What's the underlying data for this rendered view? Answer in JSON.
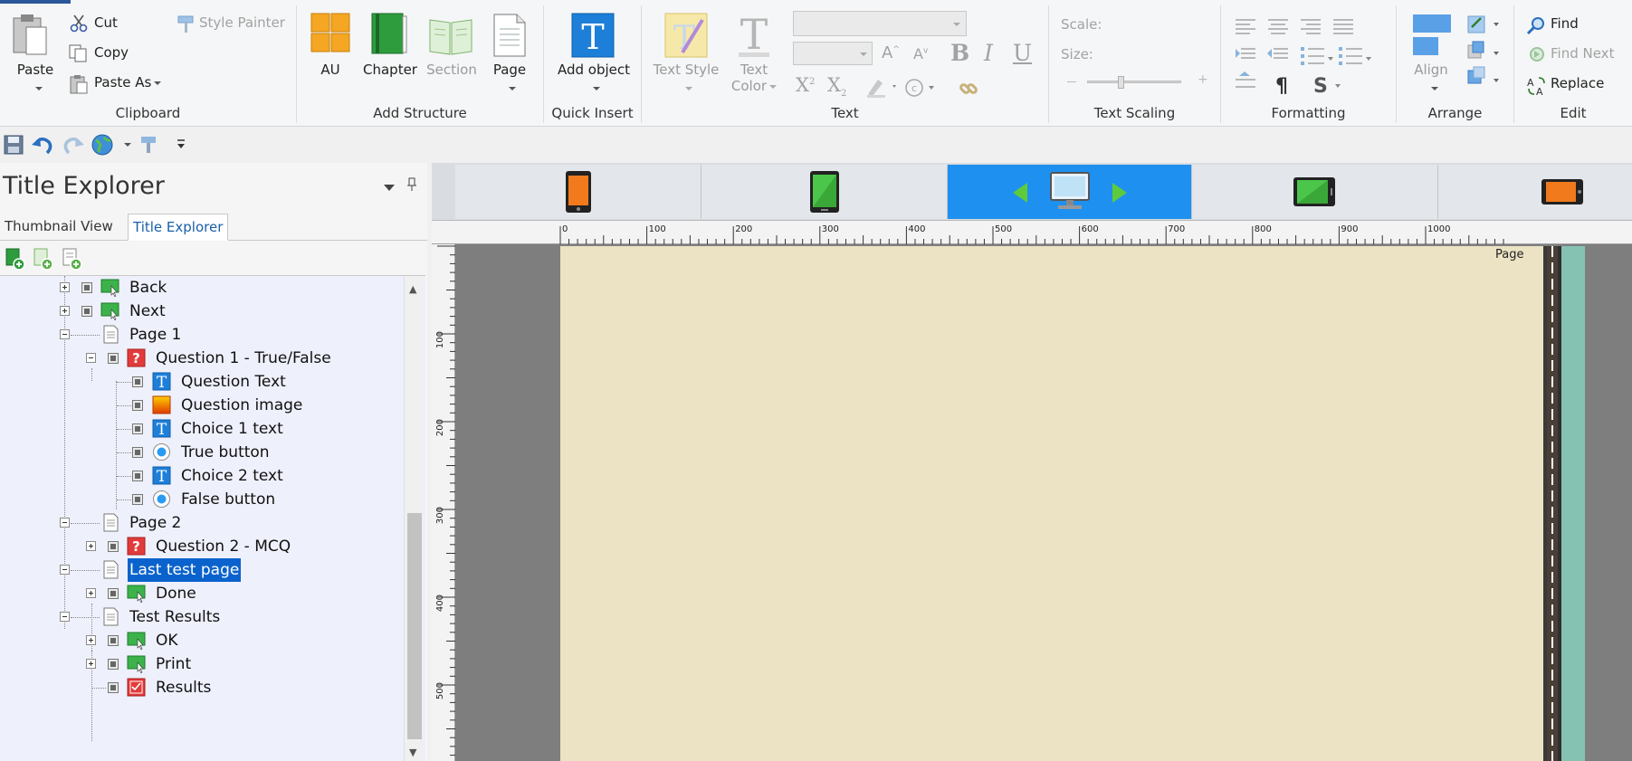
{
  "ribbon": {
    "clipboard": {
      "label": "Clipboard",
      "paste": "Paste",
      "cut": "Cut",
      "copy": "Copy",
      "paste_as": "Paste As",
      "style_painter": "Style Painter"
    },
    "add_structure": {
      "label": "Add Structure",
      "au": "AU",
      "chapter": "Chapter",
      "section": "Section",
      "page": "Page"
    },
    "quick_insert": {
      "label": "Quick Insert",
      "add_object": "Add object"
    },
    "text": {
      "label": "Text",
      "text_style": "Text Style",
      "text_color_1": "Text",
      "text_color_2": "Color",
      "bold": "B",
      "italic": "I",
      "underline": "U"
    },
    "text_scaling": {
      "label": "Text Scaling",
      "scale": "Scale:",
      "size": "Size:"
    },
    "formatting": {
      "label": "Formatting"
    },
    "arrange": {
      "label": "Arrange",
      "align": "Align"
    },
    "edit": {
      "label": "Edit",
      "find": "Find",
      "find_next": "Find Next",
      "replace": "Replace"
    }
  },
  "panel": {
    "title": "Title Explorer",
    "tabs": [
      "Thumbnail View",
      "Title Explorer"
    ],
    "active_tab": "Title Explorer"
  },
  "tree": [
    {
      "label": "Back",
      "icon": "button-icon"
    },
    {
      "label": "Next",
      "icon": "button-icon"
    },
    {
      "label": "Page 1",
      "icon": "page-icon"
    },
    {
      "label": "Question 1  - True/False",
      "icon": "question-icon"
    },
    {
      "label": "Question Text",
      "icon": "text-icon"
    },
    {
      "label": "Question image",
      "icon": "image-icon"
    },
    {
      "label": "Choice 1 text",
      "icon": "text-icon"
    },
    {
      "label": "True button",
      "icon": "radio-icon"
    },
    {
      "label": "Choice 2 text",
      "icon": "text-icon"
    },
    {
      "label": "False button",
      "icon": "radio-icon"
    },
    {
      "label": "Page 2",
      "icon": "page-icon"
    },
    {
      "label": "Question 2 - MCQ",
      "icon": "question-icon"
    },
    {
      "label": "Last test page",
      "icon": "page-icon",
      "selected": true
    },
    {
      "label": "Done",
      "icon": "button-icon"
    },
    {
      "label": "Test Results",
      "icon": "page-icon"
    },
    {
      "label": "OK",
      "icon": "button-icon"
    },
    {
      "label": "Print",
      "icon": "button-icon"
    },
    {
      "label": "Results",
      "icon": "results-icon"
    }
  ],
  "canvas": {
    "page_label": "Page",
    "devices": [
      "phone-portrait",
      "tablet-portrait",
      "desktop",
      "tablet-landscape",
      "phone-landscape"
    ],
    "active_device": "desktop",
    "ruler_h": [
      "0",
      "100",
      "200",
      "300",
      "400",
      "500",
      "600",
      "700",
      "800",
      "900",
      "1000"
    ],
    "ruler_v": [
      "100",
      "200",
      "300",
      "400",
      "500"
    ]
  },
  "colors": {
    "accent": "#1e90f0",
    "selection": "#0a63cc",
    "page_background": "#ece3c4",
    "tree_background": "#eef0fb"
  }
}
